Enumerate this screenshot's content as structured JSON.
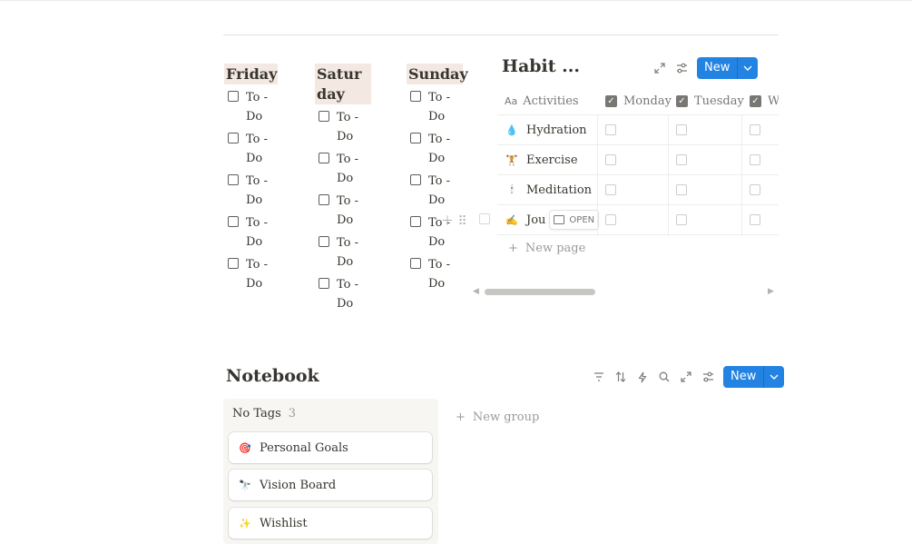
{
  "days": [
    {
      "title": "Friday",
      "todos": [
        "To - Do",
        "To - Do",
        "To - Do",
        "To - Do",
        "To - Do"
      ]
    },
    {
      "title": "Saturday",
      "todos": [
        "To - Do",
        "To - Do",
        "To - Do",
        "To - Do",
        "To - Do"
      ]
    },
    {
      "title": "Sunday",
      "todos": [
        "To - Do",
        "To - Do",
        "To - Do",
        "To - Do",
        "To - Do"
      ]
    }
  ],
  "habit": {
    "title": "Habit ...",
    "new_label": "New",
    "columns": [
      "Activities",
      "Monday",
      "Tuesday",
      "W"
    ],
    "rows": [
      {
        "emoji": "💧",
        "name": "Hydration"
      },
      {
        "emoji": "🏋",
        "name": "Exercise"
      },
      {
        "emoji": "🕯",
        "name": "Meditation"
      },
      {
        "emoji": "✍",
        "name": "Jou"
      }
    ],
    "open_label": "OPEN",
    "new_page": "New page"
  },
  "notebook": {
    "title": "Notebook",
    "new_label": "New",
    "group": {
      "name": "No Tags",
      "count": "3"
    },
    "cards": [
      {
        "emoji": "🎯",
        "title": "Personal Goals"
      },
      {
        "emoji": "🔭",
        "title": "Vision Board"
      },
      {
        "emoji": "✨",
        "title": "Wishlist"
      }
    ],
    "new_group": "New group"
  },
  "colors": {
    "accent": "#2383e2",
    "day_header_bg": "#f4e8e2",
    "group_bg": "#f7f6f3"
  }
}
